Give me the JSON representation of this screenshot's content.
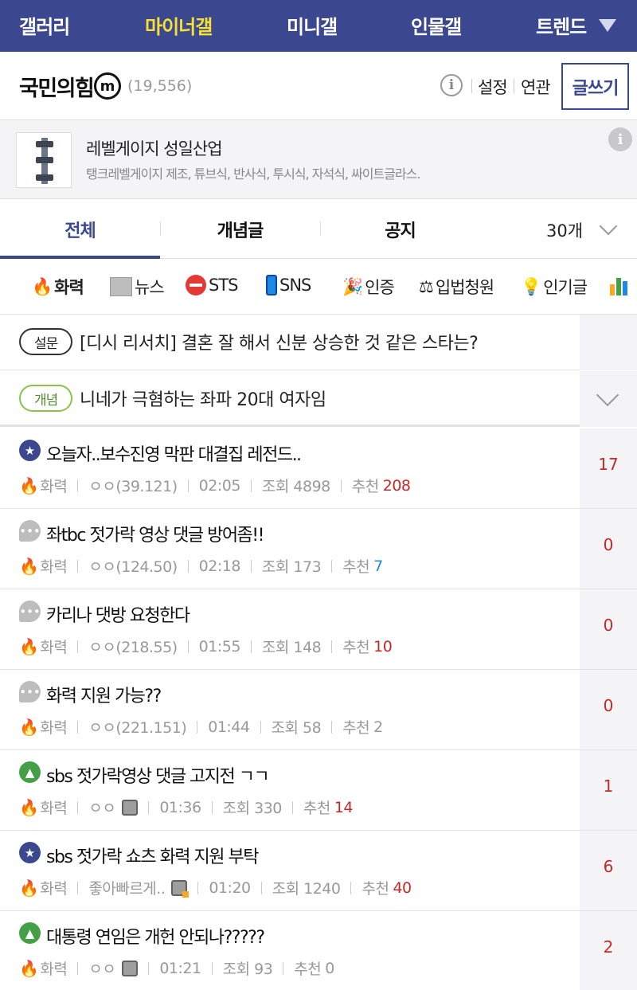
{
  "topnav": {
    "items": [
      "갤러리",
      "마이너갤",
      "미니갤",
      "인물갤",
      "트렌드"
    ],
    "active_index": 1,
    "colors": {
      "bg": "#3b4890",
      "active": "#f7e034"
    }
  },
  "gallery": {
    "title": "국민의힘",
    "badge": "m",
    "count": "(19,556)",
    "links": [
      "설정",
      "연관"
    ],
    "write_label": "글쓰기"
  },
  "ad": {
    "name": "레벨게이지 성일산업",
    "desc": "탱크레벨게이지 제조, 튜브식, 반사식, 투시식, 자석식, 싸이트글라스."
  },
  "tabs": {
    "items": [
      "전체",
      "개념글",
      "공지"
    ],
    "active_index": 0,
    "page_size": "30개"
  },
  "categories": [
    {
      "label": "화력",
      "icon": "fire-icon"
    },
    {
      "label": "뉴스",
      "icon": "newspaper-icon"
    },
    {
      "label": "STS",
      "icon": "no-entry-icon"
    },
    {
      "label": "SNS",
      "icon": "phone-icon"
    },
    {
      "label": "인증",
      "icon": "party-popper-icon"
    },
    {
      "label": "입법청원",
      "icon": "scales-icon"
    },
    {
      "label": "인기글",
      "icon": "lightbulb-icon"
    }
  ],
  "notices": [
    {
      "badge": "설문",
      "text": "[디시 리서치] 결혼 잘 해서 신분 상승한 것 같은 스타는?"
    },
    {
      "badge": "개념",
      "text": "니네가 극혐하는 좌파 20대 여자임"
    }
  ],
  "posts": [
    {
      "icon": "star",
      "title": "오늘자..보수진영 막판 대결집 레전드..",
      "cat": "화력",
      "author": "ㅇㅇ(39.121)",
      "time": "02:05",
      "views": "조회 4898",
      "rec_label": "추천",
      "rec": "208",
      "rec_color": "red",
      "replies": "17"
    },
    {
      "icon": "talk",
      "title": "좌tbc 젓가락 영상 댓글 방어좀!!",
      "cat": "화력",
      "author": "ㅇㅇ(124.50)",
      "time": "02:18",
      "views": "조회 173",
      "rec_label": "추천",
      "rec": "7",
      "rec_color": "blue",
      "replies": "0"
    },
    {
      "icon": "talk",
      "title": "카리나 댓방 요청한다",
      "cat": "화력",
      "author": "ㅇㅇ(218.55)",
      "time": "01:55",
      "views": "조회 148",
      "rec_label": "추천",
      "rec": "10",
      "rec_color": "red",
      "replies": "0"
    },
    {
      "icon": "talk",
      "title": "화력 지원 가능??",
      "cat": "화력",
      "author": "ㅇㅇ(221.151)",
      "time": "01:44",
      "views": "조회 58",
      "rec_label": "추천",
      "rec": "2",
      "rec_color": "grey",
      "replies": "0"
    },
    {
      "icon": "img",
      "title": "sbs 젓가락영상 댓글 고지전 ㄱㄱ",
      "cat": "화력",
      "author": "ㅇㅇ",
      "nick_icon": "plain",
      "time": "01:36",
      "views": "조회 330",
      "rec_label": "추천",
      "rec": "14",
      "rec_color": "red",
      "replies": "1"
    },
    {
      "icon": "star",
      "title": "sbs 젓가락 쇼츠 화력 지원 부탁",
      "cat": "화력",
      "author": "좋아빠르게..",
      "nick_icon": "gold",
      "time": "01:20",
      "views": "조회 1240",
      "rec_label": "추천",
      "rec": "40",
      "rec_color": "red",
      "replies": "6"
    },
    {
      "icon": "img",
      "title": "대통령 연임은 개헌 안되나?????",
      "cat": "화력",
      "author": "ㅇㅇ",
      "nick_icon": "plain",
      "time": "01:21",
      "views": "조회 93",
      "rec_label": "추천",
      "rec": "0",
      "rec_color": "grey",
      "replies": "2"
    }
  ]
}
